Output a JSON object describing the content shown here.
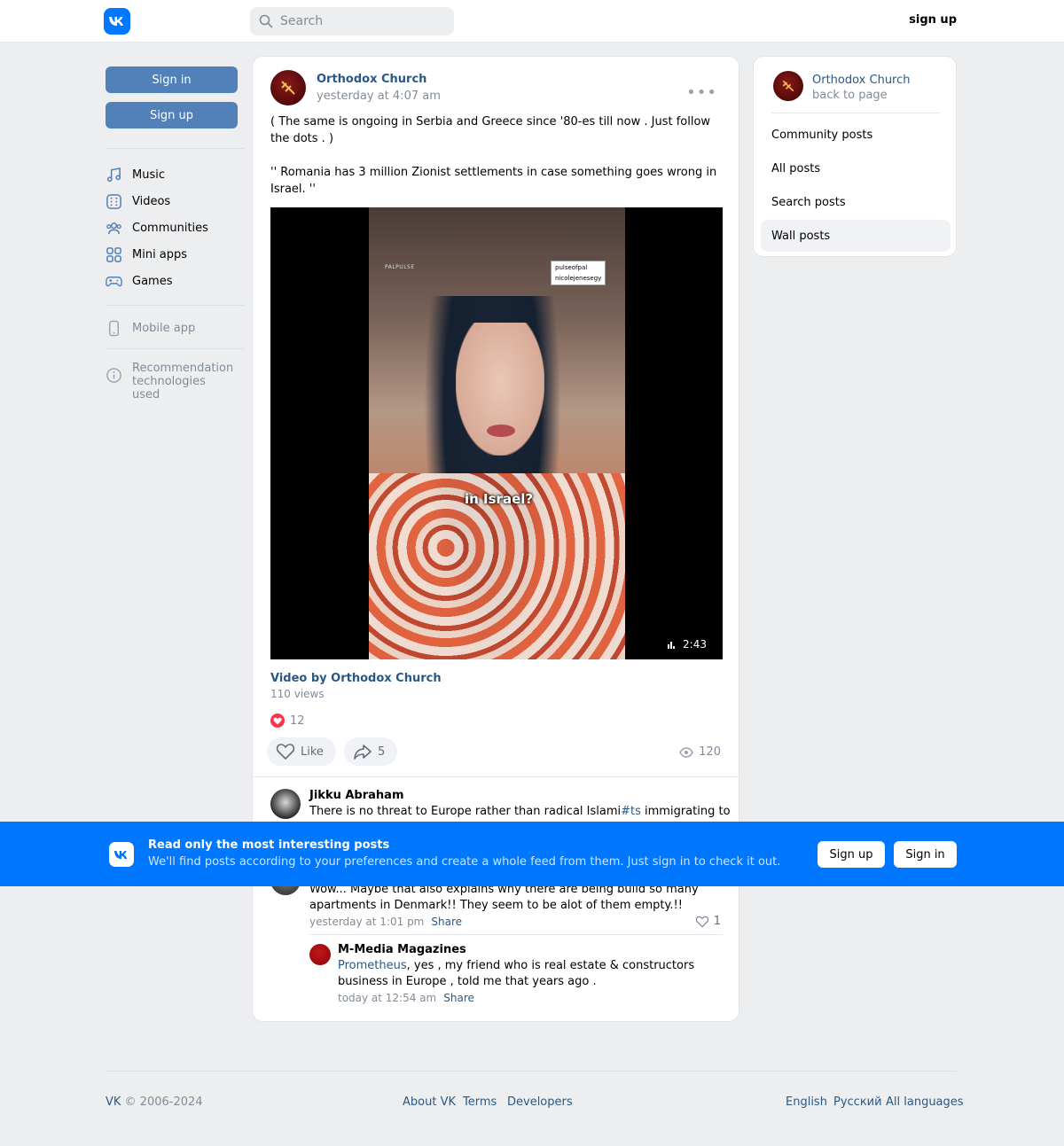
{
  "header": {
    "search_placeholder": "Search",
    "signup_label": "sign up"
  },
  "left": {
    "signin_label": "Sign in",
    "signup_label": "Sign up",
    "nav": [
      {
        "label": "Music",
        "icon": "music-icon"
      },
      {
        "label": "Videos",
        "icon": "videos-icon"
      },
      {
        "label": "Communities",
        "icon": "communities-icon"
      },
      {
        "label": "Mini apps",
        "icon": "mini-apps-icon"
      },
      {
        "label": "Games",
        "icon": "games-icon"
      }
    ],
    "mobile_app": "Mobile app",
    "recommendation": "Recommendation technologies used"
  },
  "post": {
    "author": "Orthodox Church",
    "date": "yesterday at 4:07 am",
    "text": "( The same is ongoing in Serbia and Greece since '80-es till now . Just follow the dots . )\n\n'' Romania has 3 million Zionist settlements in case something goes wrong in Israel. ''",
    "video": {
      "caption": "in Israel?",
      "watermark_1": "pulseofpal",
      "watermark_2": "nicolejenesegy",
      "watermark_logo": "PALPULSE",
      "duration": "2:43",
      "title": "Video by Orthodox Church",
      "views": "110 views"
    },
    "reactions_count": "12",
    "like_label": "Like",
    "share_count": "5",
    "views": "120"
  },
  "comments": [
    {
      "name": "Jikku Abraham",
      "text_before": "There is no threat to Europe rather than radical Islami",
      "hashtag": "#ts",
      "text_after": " immigrating to"
    },
    {
      "text": "Wow... Maybe that also explains why there are being build so many apartments in Denmark!! They seem to be alot of them empty.!!",
      "meta": "yesterday at 1:01 pm",
      "share": "Share",
      "likes": "1"
    },
    {
      "name": "M-Media Magazines",
      "mention": "Prometheus",
      "text": ", yes , my friend who is real estate & constructors business in Europe , told me that years ago .",
      "meta": "today at 12:54 am",
      "share": "Share"
    }
  ],
  "right": {
    "name": "Orthodox Church",
    "back": "back to page",
    "items": [
      "Community posts",
      "All posts",
      "Search posts",
      "Wall posts"
    ]
  },
  "banner": {
    "title": "Read only the most interesting posts",
    "subtitle": "We'll find posts according to your preferences and create a whole feed from them. Just sign in to check it out.",
    "signup": "Sign up",
    "signin": "Sign in"
  },
  "footer": {
    "brand": "VK",
    "copyright": " © 2006-2024",
    "links": [
      "About VK",
      "Terms",
      "Developers"
    ],
    "languages": [
      "English",
      "Русский",
      "All languages"
    ]
  },
  "colors": {
    "brand_blue": "#0077ff",
    "button_blue": "#5181b8",
    "link": "#2a5885",
    "like_red": "#ff3347"
  }
}
